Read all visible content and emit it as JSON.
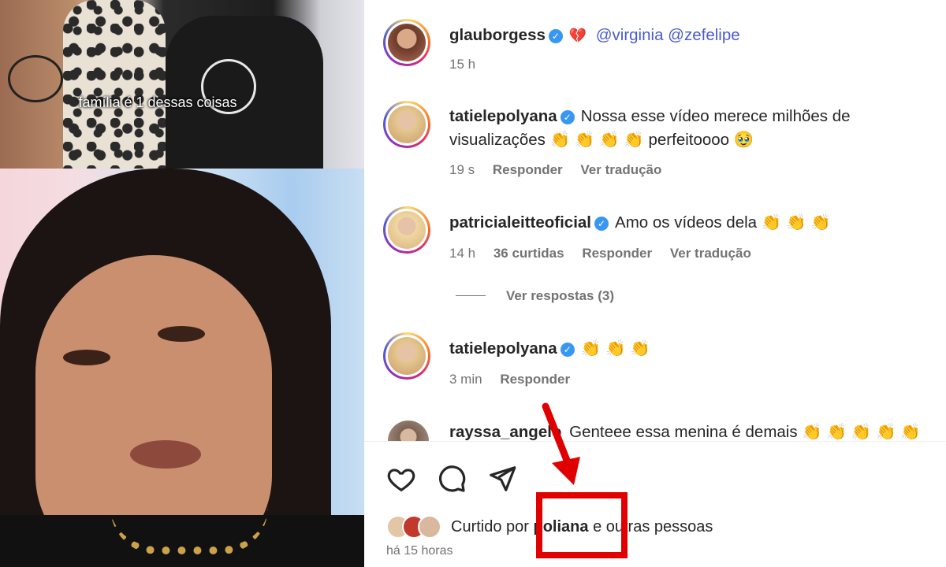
{
  "media": {
    "caption": "família é 1 dessas coisas"
  },
  "comments": [
    {
      "username": "glauborgess",
      "verified": true,
      "text_parts": [
        "💔",
        "@virginia @zefelipe"
      ],
      "emoji": "💔",
      "mentions": "@virginia @zefelipe",
      "time": "15 h"
    },
    {
      "username": "tatielepolyana",
      "verified": true,
      "text": "Nossa esse vídeo merece milhões de",
      "text2": "visualizações 👏 👏 👏 👏 perfeitoooo 🥹",
      "time": "19 s",
      "reply": "Responder",
      "translate": "Ver tradução"
    },
    {
      "username": "patricialeitteoficial",
      "verified": true,
      "text": "Amo os vídeos dela 👏 👏 👏",
      "time": "14 h",
      "likes": "36 curtidas",
      "reply": "Responder",
      "translate": "Ver tradução",
      "view_replies": "Ver respostas (3)"
    },
    {
      "username": "tatielepolyana",
      "verified": true,
      "text": "👏 👏 👏",
      "time": "3 min",
      "reply": "Responder"
    },
    {
      "username": "rayssa_angelo",
      "verified": false,
      "text": "Genteee essa menina é demais 👏 👏 👏 👏 👏"
    }
  ],
  "actions": {
    "like_icon": "heart-icon",
    "comment_icon": "comment-icon",
    "share_icon": "send-icon"
  },
  "likes": {
    "prefix": "Curtido por",
    "user": "poliana",
    "suffix": "e outras pessoas"
  },
  "posted": "há 15 horas",
  "colors": {
    "verified": "#3897f0",
    "mention": "#4a5bd0",
    "meta": "#737373",
    "annotation": "#e00000"
  }
}
